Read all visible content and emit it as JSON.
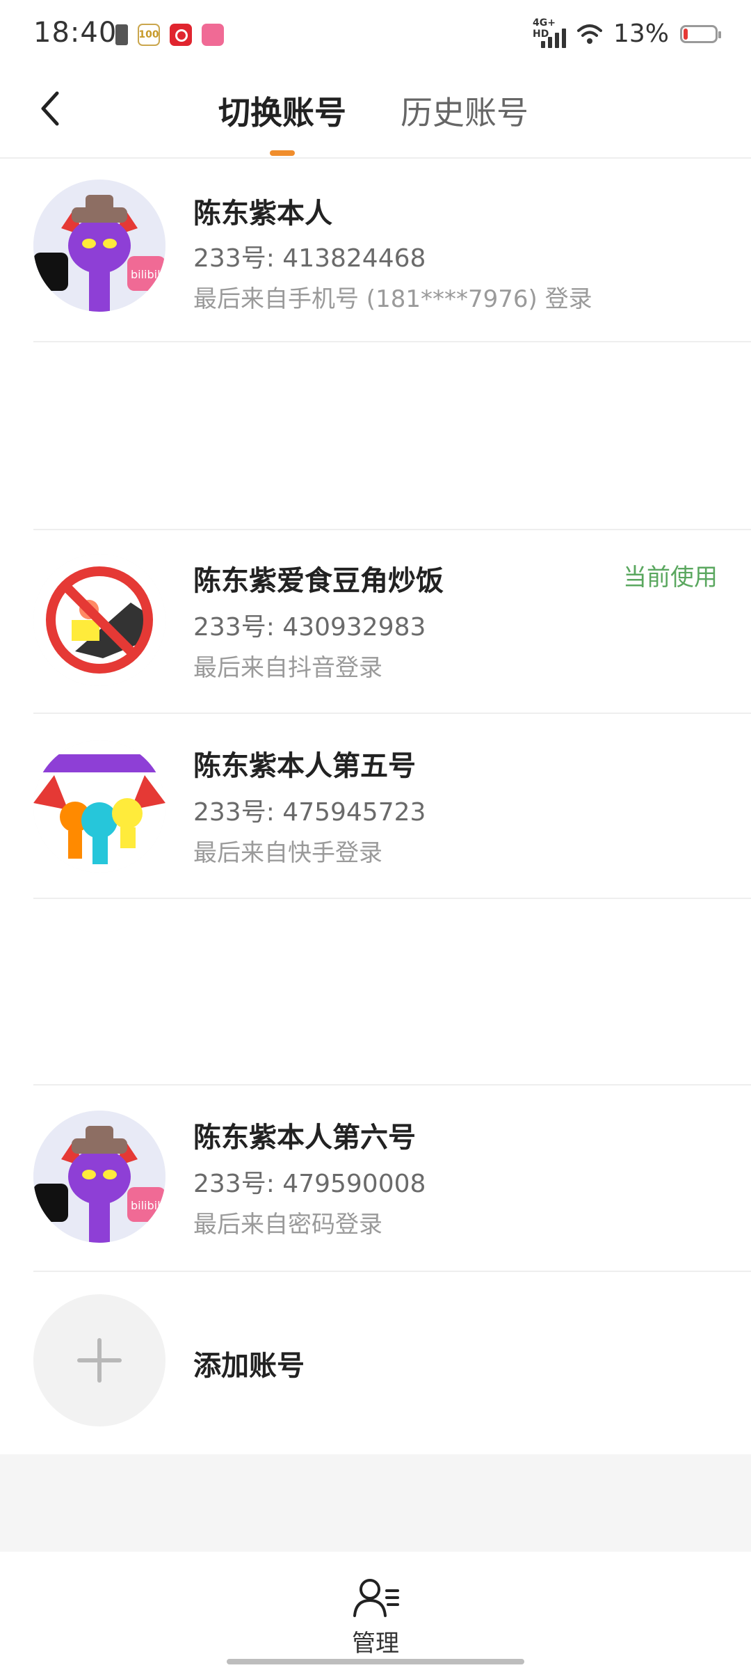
{
  "status_bar": {
    "time": "18:40",
    "app_icons": [
      "sim-icon",
      "app-100-icon",
      "netease-music-icon",
      "bilibili-icon"
    ],
    "app_100_label": "100",
    "network_tag": "4G+ HD",
    "battery_percent": "13%",
    "battery_level": 0.13,
    "battery_color": "#e53935"
  },
  "header": {
    "tabs": [
      {
        "label": "切换账号",
        "active": true
      },
      {
        "label": "历史账号",
        "active": false
      }
    ],
    "accent_color": "#f08d2c"
  },
  "accounts": [
    {
      "name": "陈东紫本人",
      "id_line": "233号: 413824468",
      "last_login": "最后来自手机号 (181****7976) 登录",
      "badge": ""
    },
    {
      "name": "陈东紫爱食豆角炒饭",
      "id_line": "233号: 430932983",
      "last_login": "最后来自抖音登录",
      "badge": "当前使用"
    },
    {
      "name": "陈东紫本人第五号",
      "id_line": "233号: 475945723",
      "last_login": "最后来自快手登录",
      "badge": ""
    },
    {
      "name": "陈东紫本人第六号",
      "id_line": "233号: 479590008",
      "last_login": "最后来自密码登录",
      "badge": ""
    }
  ],
  "add_account": {
    "label": "添加账号"
  },
  "bottom_bar": {
    "manage_label": "管理"
  }
}
